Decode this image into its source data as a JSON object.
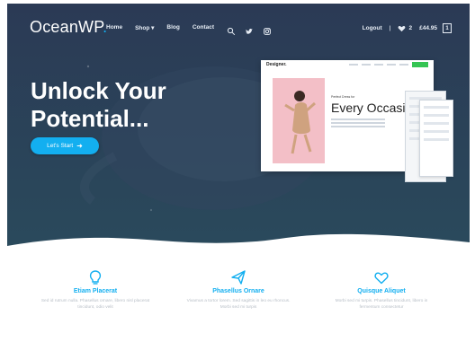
{
  "brand": {
    "name": "OceanWP",
    "dot": "."
  },
  "colors": {
    "accent": "#13aff0",
    "hero_bg": "#2c3d58",
    "mock_pink": "#f3bfc7",
    "text_muted": "#b7bec6"
  },
  "nav": {
    "items": [
      "Home",
      "Shop",
      "Blog",
      "Contact"
    ],
    "shop_chevron": "▾",
    "search_icon": "search-icon",
    "twitter_icon": "twitter-icon",
    "instagram_icon": "instagram-icon",
    "logout": "Logout",
    "separator": "|",
    "wishlist_count": "2",
    "cart_total": "£44.95",
    "cart_count": "1"
  },
  "hero": {
    "title_line1": "Unlock Your",
    "title_line2": "Potential...",
    "cta_label": "Let's Start"
  },
  "mock": {
    "brand": "Designer.",
    "heading": "Every Occasion",
    "subheading": "Perfect Dress for"
  },
  "features": [
    {
      "icon": "lightbulb-icon",
      "title": "Etiam Placerat",
      "text": "Sed id rutrum nulla. Phasellus ornare, libero nisl placerat tincidunt, odio velit"
    },
    {
      "icon": "paper-plane-icon",
      "title": "Phasellus Ornare",
      "text": "Vivamus a tortor lorem. Sed sagittis in leo eu rhoncus. Morbi sed mi turpis"
    },
    {
      "icon": "heart-icon",
      "title": "Quisque Aliquet",
      "text": "Morbi sed mi turpis. Phasellus tincidunt, libero in fermentum consectetur"
    }
  ]
}
